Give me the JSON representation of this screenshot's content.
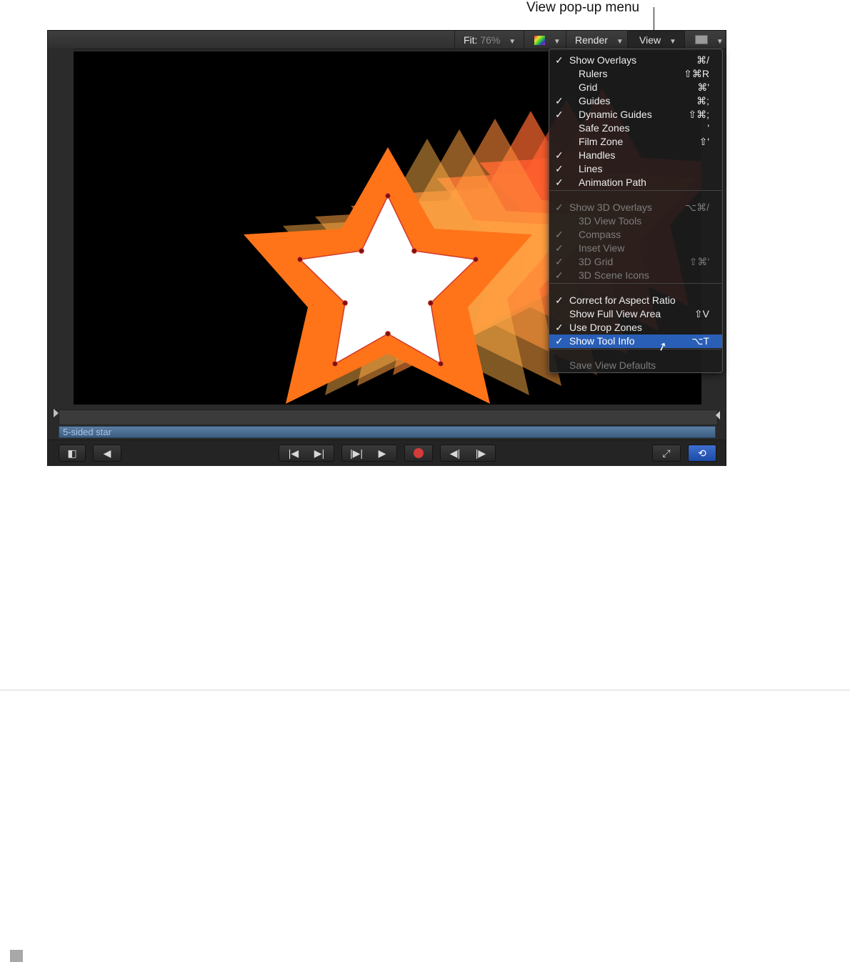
{
  "callout": {
    "label": "View pop-up menu"
  },
  "toolbar": {
    "fit_label": "Fit:",
    "fit_value": "76%",
    "render_label": "Render",
    "view_label": "View"
  },
  "menu": {
    "items": [
      {
        "check": "✓",
        "label": "Show Overlays",
        "shortcut": "⌘/",
        "indent": false,
        "disabled": false
      },
      {
        "check": "",
        "label": "Rulers",
        "shortcut": "⇧⌘R",
        "indent": true,
        "disabled": false
      },
      {
        "check": "",
        "label": "Grid",
        "shortcut": "⌘'",
        "indent": true,
        "disabled": false
      },
      {
        "check": "✓",
        "label": "Guides",
        "shortcut": "⌘;",
        "indent": true,
        "disabled": false
      },
      {
        "check": "✓",
        "label": "Dynamic Guides",
        "shortcut": "⇧⌘;",
        "indent": true,
        "disabled": false
      },
      {
        "check": "",
        "label": "Safe Zones",
        "shortcut": "'",
        "indent": true,
        "disabled": false
      },
      {
        "check": "",
        "label": "Film Zone",
        "shortcut": "⇧'",
        "indent": true,
        "disabled": false
      },
      {
        "check": "✓",
        "label": "Handles",
        "shortcut": "",
        "indent": true,
        "disabled": false
      },
      {
        "check": "✓",
        "label": "Lines",
        "shortcut": "",
        "indent": true,
        "disabled": false
      },
      {
        "check": "✓",
        "label": "Animation Path",
        "shortcut": "",
        "indent": true,
        "disabled": false
      },
      {
        "check": "✓",
        "label": "Show 3D Overlays",
        "shortcut": "⌥⌘/",
        "indent": false,
        "disabled": true
      },
      {
        "check": "",
        "label": "3D View Tools",
        "shortcut": "",
        "indent": true,
        "disabled": true
      },
      {
        "check": "✓",
        "label": "Compass",
        "shortcut": "",
        "indent": true,
        "disabled": true
      },
      {
        "check": "✓",
        "label": "Inset View",
        "shortcut": "",
        "indent": true,
        "disabled": true
      },
      {
        "check": "✓",
        "label": "3D Grid",
        "shortcut": "⇧⌘'",
        "indent": true,
        "disabled": true
      },
      {
        "check": "✓",
        "label": "3D Scene Icons",
        "shortcut": "",
        "indent": true,
        "disabled": true
      },
      {
        "check": "✓",
        "label": "Correct for Aspect Ratio",
        "shortcut": "",
        "indent": false,
        "disabled": false
      },
      {
        "check": "",
        "label": "Show Full View Area",
        "shortcut": "⇧V",
        "indent": false,
        "disabled": false
      },
      {
        "check": "✓",
        "label": "Use Drop Zones",
        "shortcut": "",
        "indent": false,
        "disabled": false
      },
      {
        "check": "✓",
        "label": "Show Tool Info",
        "shortcut": "⌥T",
        "indent": false,
        "disabled": false,
        "highlighted": true
      },
      {
        "check": "",
        "label": "Save View Defaults",
        "shortcut": "",
        "indent": false,
        "disabled": true
      }
    ]
  },
  "timeline": {
    "track_label": "5-sided star"
  },
  "transport": {
    "layers_icon": "layers-icon",
    "audio_icon": "speaker-icon",
    "go_start_icon": "go-to-start-icon",
    "go_end_icon": "go-to-end-icon",
    "play_from_start_icon": "play-from-start-icon",
    "play_icon": "play-icon",
    "record_icon": "record-icon",
    "prev_frame_icon": "previous-frame-icon",
    "next_frame_icon": "next-frame-icon",
    "fullscreen_icon": "fullscreen-icon",
    "loop_icon": "loop-icon"
  },
  "colors": {
    "highlight": "#2a5fb8",
    "star_orange": "#ff7a1a",
    "star_red": "#ff3a2a",
    "track_blue": "#4a6d93"
  }
}
